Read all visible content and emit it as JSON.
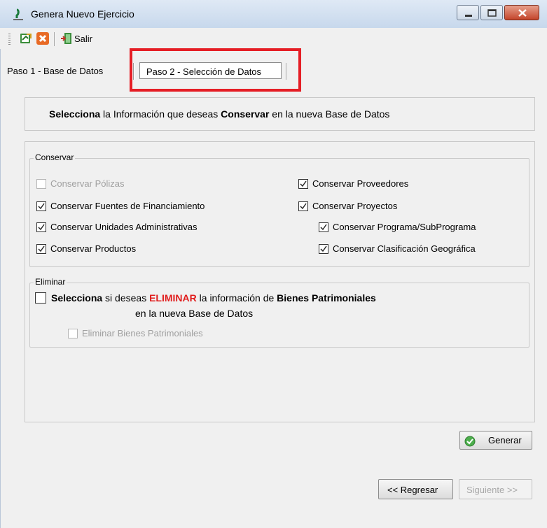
{
  "window": {
    "title": "Genera Nuevo Ejercicio"
  },
  "toolbar": {
    "exit_label": "Salir"
  },
  "tabs": [
    {
      "label": "Paso 1 - Base de Datos",
      "selected": false
    },
    {
      "label": "Paso 2 - Selección de Datos",
      "selected": true
    }
  ],
  "banner": {
    "part1": "Selecciona",
    "part2": " la Información que deseas ",
    "part3": "Conservar",
    "part4": " en la nueva Base de Datos"
  },
  "conservar": {
    "title": "Conservar",
    "left": [
      {
        "label": "Conservar Pólizas",
        "checked": false,
        "enabled": false
      },
      {
        "label": "Conservar Fuentes de Financiamiento",
        "checked": true,
        "enabled": true
      },
      {
        "label": "Conservar Unidades Administrativas",
        "checked": true,
        "enabled": true
      },
      {
        "label": "Conservar Productos",
        "checked": true,
        "enabled": true
      }
    ],
    "right": [
      {
        "label": "Conservar Proveedores",
        "checked": true,
        "enabled": true
      },
      {
        "label": "Conservar Proyectos",
        "checked": true,
        "enabled": true
      },
      {
        "label": "Conservar Programa/SubPrograma",
        "checked": true,
        "enabled": true
      },
      {
        "label": "Conservar Clasificación Geográfica",
        "checked": true,
        "enabled": true
      }
    ]
  },
  "eliminar": {
    "title": "Eliminar",
    "part1": "Selecciona",
    "part2": " si deseas ",
    "part3": "ELIMINAR",
    "part4": "  la información de ",
    "part5": "Bienes Patrimoniales",
    "line2": "en la nueva Base de Datos",
    "sub_option": {
      "label": "Eliminar Bienes Patrimoniales",
      "checked": false,
      "enabled": false
    }
  },
  "buttons": {
    "generar": "Generar",
    "regresar": "<< Regresar",
    "siguiente": "Siguiente >>"
  },
  "colors": {
    "highlight": "#e51e25",
    "eliminar_red": "#e01b1b"
  }
}
